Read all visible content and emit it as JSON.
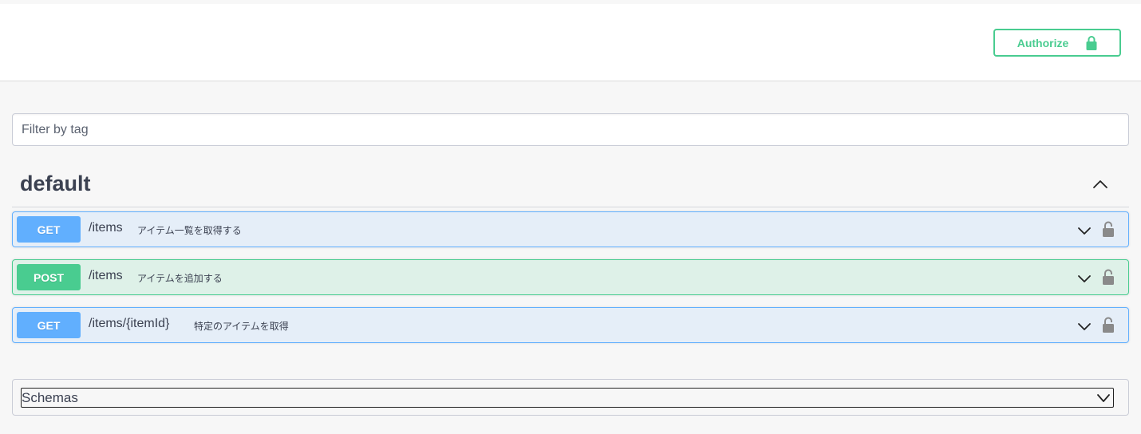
{
  "header": {
    "authorize_label": "Authorize",
    "lock_icon": "lock-icon"
  },
  "filter": {
    "placeholder": "Filter by tag",
    "value": ""
  },
  "tag": {
    "title": "default",
    "expanded": true,
    "toggle_icon": "chevron-up-icon"
  },
  "operations": [
    {
      "method": "GET",
      "path": "/items",
      "summary": "アイテム一覧を取得する",
      "color": "#61affe"
    },
    {
      "method": "POST",
      "path": "/items",
      "summary": "アイテムを追加する",
      "color": "#49cc90"
    },
    {
      "method": "GET",
      "path": "/items/{itemId}",
      "summary": "特定のアイテムを取得",
      "color": "#61affe"
    }
  ],
  "schemas": {
    "label": "Schemas",
    "toggle_icon": "chevron-down-icon"
  },
  "colors": {
    "get": "#61affe",
    "post": "#49cc90",
    "authorize": "#49cc90",
    "text": "#3b4151"
  }
}
